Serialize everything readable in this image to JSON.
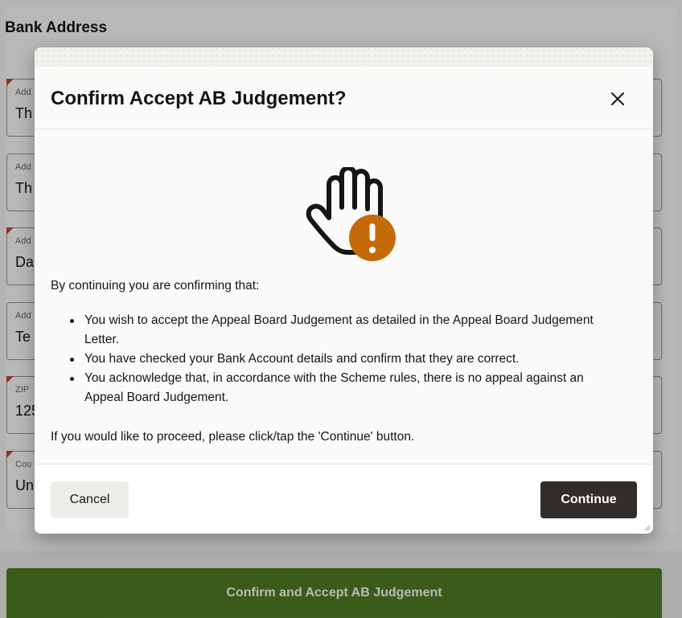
{
  "background": {
    "section_title": "Bank Address",
    "fields": [
      {
        "label": "Add",
        "value": "Th",
        "required": true
      },
      {
        "label": "Add",
        "value": "Th",
        "required": false
      },
      {
        "label": "Add",
        "value": "Da",
        "required": true
      },
      {
        "label": "Add",
        "value": "Te",
        "required": false
      },
      {
        "label": "ZIP",
        "value": "125",
        "required": true
      },
      {
        "label": "Cou",
        "value": "Un",
        "required": true
      }
    ],
    "primary_action_label": "Confirm and Accept AB Judgement",
    "primary_action_color": "#508223"
  },
  "dialog": {
    "title": "Confirm Accept AB Judgement?",
    "icon": "raised-hand-warning-icon",
    "icon_accent_color": "#c46a08",
    "intro": "By continuing you are confirming that:",
    "bullets": [
      "You wish to accept the Appeal Board Judgement as detailed in the Appeal Board Judgement Letter.",
      "You have checked your Bank Account details and confirm that they are correct.",
      "You acknowledge that, in accordance with the Scheme rules, there is no appeal against an Appeal Board Judgement."
    ],
    "outro": "If you would like to proceed, please click/tap the 'Continue' button.",
    "cancel_label": "Cancel",
    "continue_label": "Continue"
  }
}
